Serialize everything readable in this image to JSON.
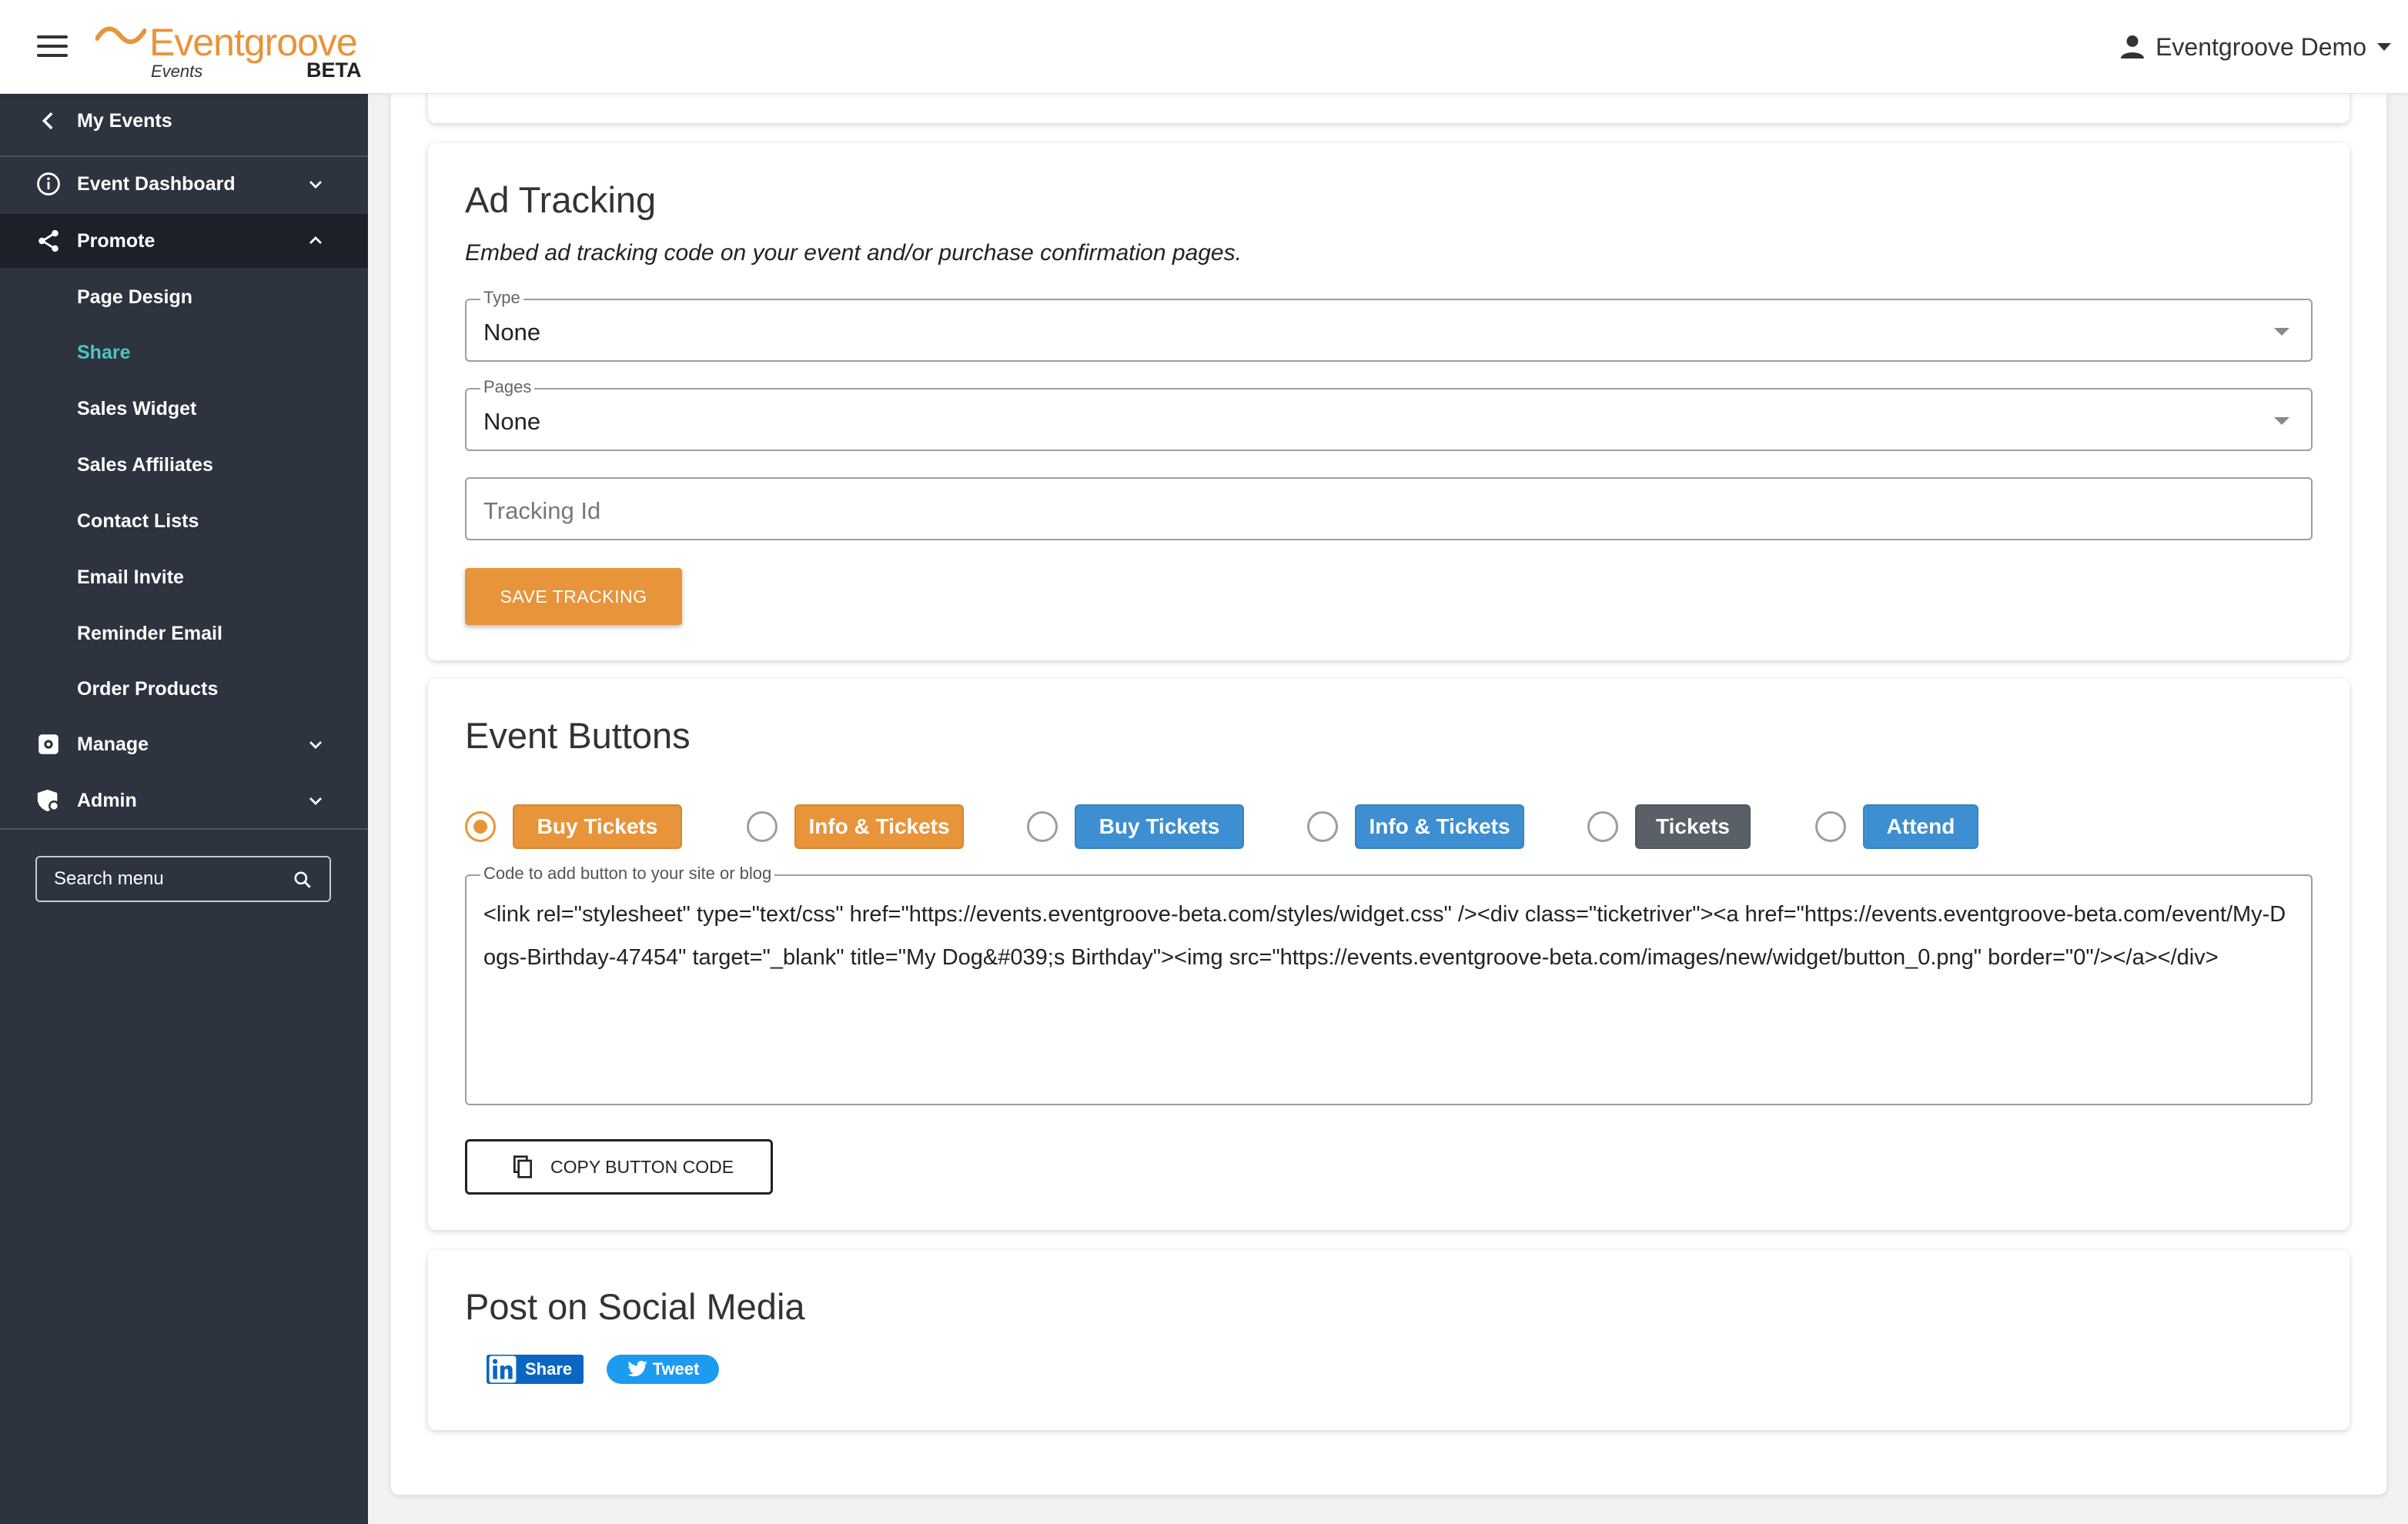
{
  "header": {
    "brand": "Eventgroove",
    "brand_sub": "Events",
    "brand_tag": "BETA",
    "user_name": "Eventgroove Demo"
  },
  "sidebar": {
    "back_label": "My Events",
    "sections": {
      "dashboard": "Event Dashboard",
      "promote": "Promote",
      "manage": "Manage",
      "admin": "Admin"
    },
    "promote_items": [
      "Page Design",
      "Share",
      "Sales Widget",
      "Sales Affiliates",
      "Contact Lists",
      "Email Invite",
      "Reminder Email",
      "Order Products"
    ],
    "selected_item": "Share",
    "search_placeholder": "Search menu"
  },
  "ad_tracking": {
    "title": "Ad Tracking",
    "description": "Embed ad tracking code on your event and/or purchase confirmation pages.",
    "type_label": "Type",
    "type_value": "None",
    "pages_label": "Pages",
    "pages_value": "None",
    "tracking_placeholder": "Tracking Id",
    "save_label": "SAVE TRACKING"
  },
  "event_buttons": {
    "title": "Event Buttons",
    "options": [
      {
        "label": "Buy Tickets",
        "color": "#e8943a",
        "checked": true
      },
      {
        "label": "Info & Tickets",
        "color": "#e8943a",
        "checked": false
      },
      {
        "label": "Buy Tickets",
        "color": "#3d8fd1",
        "checked": false
      },
      {
        "label": "Info & Tickets",
        "color": "#3d8fd1",
        "checked": false
      },
      {
        "label": "Tickets",
        "color": "#5a6068",
        "checked": false
      },
      {
        "label": "Attend",
        "color": "#3d8fd1",
        "checked": false
      }
    ],
    "code_label": "Code to add button to your site or blog",
    "code_value": "<link rel=\"stylesheet\" type=\"text/css\" href=\"https://events.eventgroove-beta.com/styles/widget.css\" /><div class=\"ticketriver\"><a href=\"https://events.eventgroove-beta.com/event/My-Dogs-Birthday-47454\" target=\"_blank\" title=\"My Dog&#039;s Birthday\"><img src=\"https://events.eventgroove-beta.com/images/new/widget/button_0.png\" border=\"0\"/></a></div>",
    "copy_label": "COPY BUTTON CODE"
  },
  "social": {
    "title": "Post on Social Media",
    "linkedin_label": "Share",
    "twitter_label": "Tweet"
  },
  "colors": {
    "accent_orange": "#e8943a",
    "sidebar_bg": "#2d333f",
    "sidebar_active": "#1c2029",
    "selected_teal": "#4fc3c2",
    "button_blue": "#3d8fd1",
    "button_gray": "#5a6068"
  }
}
